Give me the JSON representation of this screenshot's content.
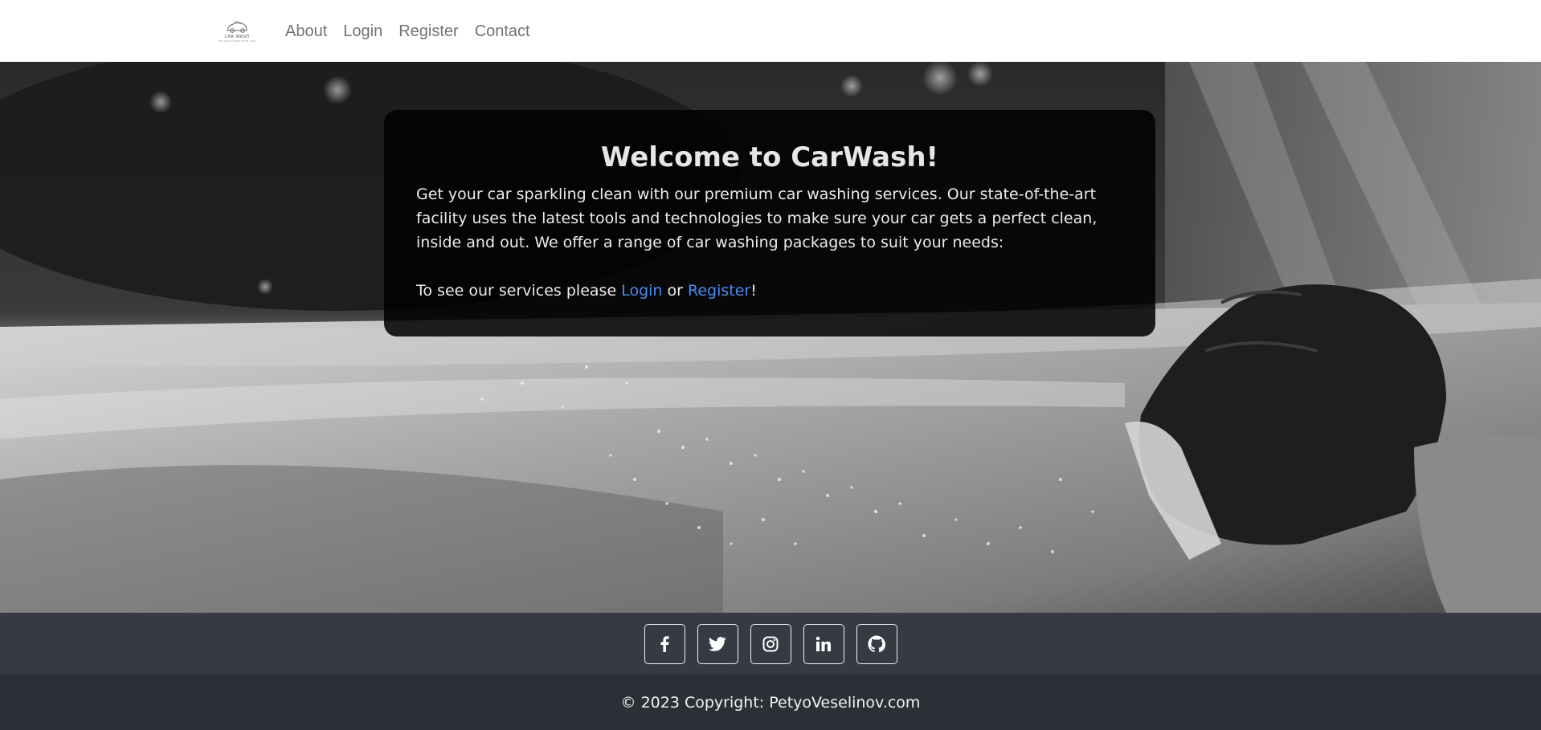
{
  "navbar": {
    "brand": {
      "icon": "car-logo-icon",
      "name": "CAR WASH",
      "tagline": "WE CAN CLEAN YOUR CAR"
    },
    "links": [
      {
        "label": "About"
      },
      {
        "label": "Login"
      },
      {
        "label": "Register"
      },
      {
        "label": "Contact"
      }
    ]
  },
  "hero": {
    "background": "black-and-white photo of a car being washed",
    "title": "Welcome to CarWash!",
    "description": "Get your car sparkling clean with our premium car washing services. Our state-of-the-art facility uses the latest tools and technologies to make sure your car gets a perfect clean, inside and out. We offer a range of car washing packages to suit your needs:",
    "cta": {
      "prefix": "To see our services please ",
      "login_label": "Login",
      "middle": " or ",
      "register_label": "Register",
      "suffix": "!"
    }
  },
  "footer": {
    "social": [
      {
        "icon": "facebook-icon"
      },
      {
        "icon": "twitter-icon"
      },
      {
        "icon": "instagram-icon"
      },
      {
        "icon": "linkedin-icon"
      },
      {
        "icon": "github-icon"
      }
    ],
    "copyright": "© 2023 Copyright: PetyoVeselinov.com"
  },
  "colors": {
    "nav_link": "#707275",
    "link_accent": "#4a8bf5",
    "social_bar": "#353a43",
    "copyright_bar": "#2b2f36",
    "card_bg": "rgba(0,0,0,0.86)"
  }
}
